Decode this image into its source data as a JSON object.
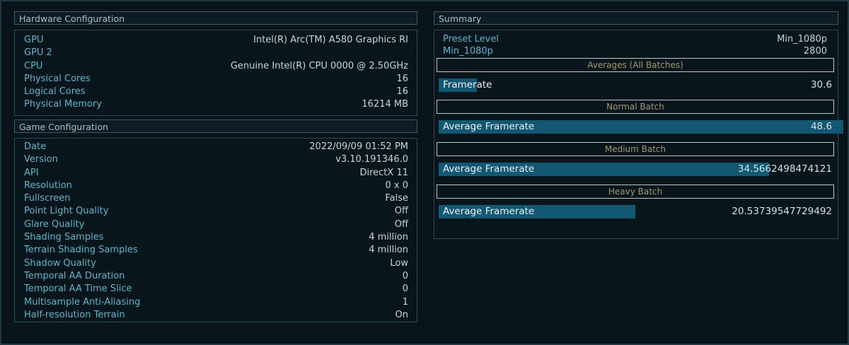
{
  "hardware": {
    "title": "Hardware Configuration",
    "rows": [
      {
        "key": "GPU",
        "value": "Intel(R) Arc(TM) A580 Graphics RI"
      },
      {
        "key": "GPU 2",
        "value": ""
      },
      {
        "key": "CPU",
        "value": "Genuine Intel(R) CPU 0000 @ 2.50GHz"
      },
      {
        "key": "Physical Cores",
        "value": "16"
      },
      {
        "key": "Logical Cores",
        "value": "16"
      },
      {
        "key": "Physical Memory",
        "value": "16214 MB"
      }
    ]
  },
  "game": {
    "title": "Game Configuration",
    "rows": [
      {
        "key": "Date",
        "value": "2022/09/09 01:52 PM"
      },
      {
        "key": "Version",
        "value": "v3.10.191346.0"
      },
      {
        "key": "API",
        "value": "DirectX 11"
      },
      {
        "key": "Resolution",
        "value": "0 x 0"
      },
      {
        "key": "Fullscreen",
        "value": "False"
      },
      {
        "key": "Point Light Quality",
        "value": "Off"
      },
      {
        "key": "Glare Quality",
        "value": "Off"
      },
      {
        "key": "Shading Samples",
        "value": "4 million"
      },
      {
        "key": "Terrain Shading Samples",
        "value": "4 million"
      },
      {
        "key": "Shadow Quality",
        "value": "Low"
      },
      {
        "key": "Temporal AA Duration",
        "value": "0"
      },
      {
        "key": "Temporal AA Time Slice",
        "value": "0"
      },
      {
        "key": "Multisample Anti-Aliasing",
        "value": "1"
      },
      {
        "key": "Half-resolution Terrain",
        "value": "On"
      }
    ]
  },
  "summary": {
    "title": "Summary",
    "preset": [
      {
        "key": "Preset Level",
        "value": "Min_1080p"
      },
      {
        "key": "Min_1080p",
        "value": "2800"
      }
    ],
    "sections": [
      {
        "header": "Averages (All Batches)",
        "label": "Framerate",
        "value": "30.6",
        "bar_fraction": 0.098
      },
      {
        "header": "Normal Batch",
        "label": "Average Framerate",
        "value": "48.6",
        "bar_fraction": 1.0
      },
      {
        "header": "Medium Batch",
        "label": "Average Framerate",
        "value": "34.5662498474121",
        "bar_fraction": 0.84
      },
      {
        "header": "Heavy Batch",
        "label": "Average Framerate",
        "value": "20.53739547729492",
        "bar_fraction": 0.5
      }
    ]
  }
}
